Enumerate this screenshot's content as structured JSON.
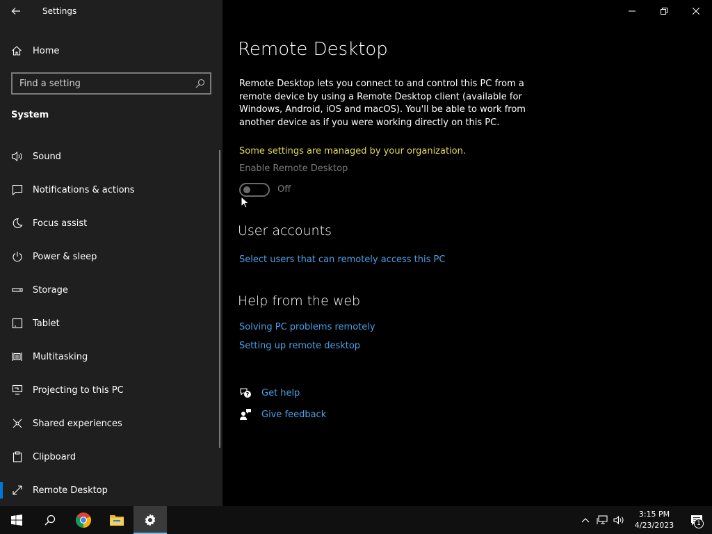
{
  "window": {
    "title": "Settings"
  },
  "sidebar": {
    "home_label": "Home",
    "search_placeholder": "Find a setting",
    "section_title": "System",
    "items": [
      {
        "label": "Sound",
        "icon": "speaker-icon"
      },
      {
        "label": "Notifications & actions",
        "icon": "chat-bubble-icon"
      },
      {
        "label": "Focus assist",
        "icon": "moon-icon"
      },
      {
        "label": "Power & sleep",
        "icon": "power-icon"
      },
      {
        "label": "Storage",
        "icon": "storage-icon"
      },
      {
        "label": "Tablet",
        "icon": "tablet-icon"
      },
      {
        "label": "Multitasking",
        "icon": "multitasking-icon"
      },
      {
        "label": "Projecting to this PC",
        "icon": "projector-icon"
      },
      {
        "label": "Shared experiences",
        "icon": "shared-icon"
      },
      {
        "label": "Clipboard",
        "icon": "clipboard-icon"
      },
      {
        "label": "Remote Desktop",
        "icon": "remote-desktop-icon",
        "active": true
      }
    ]
  },
  "main": {
    "title": "Remote Desktop",
    "description": "Remote Desktop lets you connect to and control this PC from a remote device by using a Remote Desktop client (available for Windows, Android, iOS and macOS). You'll be able to work from another device as if you were working directly on this PC.",
    "managed_notice": "Some settings are managed by your organization.",
    "enable_label": "Enable Remote Desktop",
    "toggle_state": "Off",
    "user_accounts_heading": "User accounts",
    "select_users_link": "Select users that can remotely access this PC",
    "help_heading": "Help from the web",
    "help_links": [
      "Solving PC problems remotely",
      "Setting up remote desktop"
    ],
    "get_help": "Get help",
    "give_feedback": "Give feedback"
  },
  "taskbar": {
    "time": "3:15 PM",
    "date": "4/23/2023",
    "notification_count": "1"
  },
  "colors": {
    "accent": "#0078d7",
    "link": "#4aa0e6",
    "warning": "#e6d95a",
    "sidebar_bg": "#1f1f1f"
  }
}
